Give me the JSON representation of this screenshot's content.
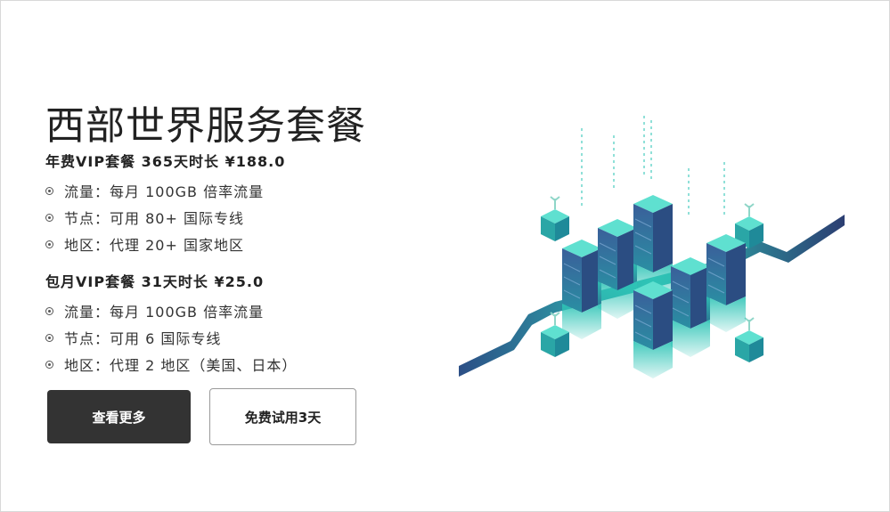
{
  "page": {
    "title": "西部世界服务套餐"
  },
  "plans": [
    {
      "name": "年费VIP套餐 365天时长 ¥188.0",
      "features": [
        "流量：每月 100GB 倍率流量",
        "节点：可用 80+ 国际专线",
        "地区：代理 20+ 国家地区"
      ]
    },
    {
      "name": "包月VIP套餐 31天时长 ¥25.0",
      "features": [
        "流量：每月 100GB 倍率流量",
        "节点：可用 6 国际专线",
        "地区：代理 2 地区（美国、日本）"
      ]
    }
  ],
  "buttons": {
    "more_label": "查看更多",
    "trial_label": "免费试用3天"
  },
  "illustration": {
    "icon": "isometric-server-datacenter-icon"
  },
  "colors": {
    "primary_button": "#333333",
    "teal": "#2ec4b6",
    "navy": "#2c3e72"
  }
}
